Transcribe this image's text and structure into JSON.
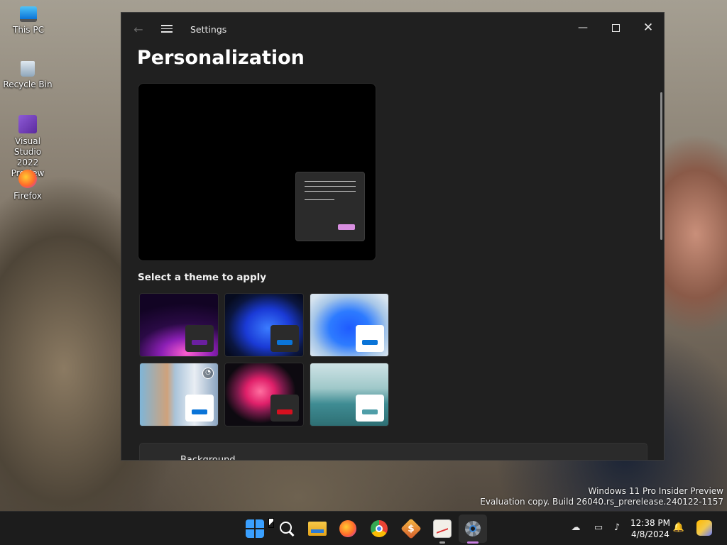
{
  "desktop": {
    "icons": [
      {
        "label": "This PC",
        "icon": "monitor-icon"
      },
      {
        "label": "Recycle Bin",
        "icon": "recycle-bin-icon"
      },
      {
        "label": "Visual Studio 2022 Preview",
        "icon": "visual-studio-icon"
      },
      {
        "label": "Firefox",
        "icon": "firefox-icon"
      }
    ],
    "watermark": {
      "line1": "Windows 11 Pro Insider Preview",
      "line2": "Evaluation copy. Build 26040.rs_prerelease.240122-1157"
    }
  },
  "window": {
    "title": "Settings",
    "controls": {
      "minimize": "—",
      "close": "✕"
    },
    "page_title": "Personalization",
    "theme_section_label": "Select a theme to apply",
    "themes": [
      {
        "name": "theme-glow-dark",
        "accent": "#6a1fa0",
        "swatch_bg": "#2b2b2b"
      },
      {
        "name": "theme-bloom-dark",
        "accent": "#0a74d8",
        "swatch_bg": "#2b2b2b"
      },
      {
        "name": "theme-bloom-light",
        "accent": "#0a74d8",
        "swatch_bg": "#ffffff"
      },
      {
        "name": "theme-spotlight",
        "accent": "#0a74d8",
        "swatch_bg": "#ffffff",
        "selected": true
      },
      {
        "name": "theme-flow",
        "accent": "#d6101f",
        "swatch_bg": "#2b2b2b"
      },
      {
        "name": "theme-sunrise",
        "accent": "#4f9ea8",
        "swatch_bg": "#ffffff"
      }
    ],
    "background_row_label": "Background"
  },
  "taskbar": {
    "apps": [
      {
        "name": "start",
        "icon": "windows-start-icon"
      },
      {
        "name": "search",
        "icon": "search-icon"
      },
      {
        "name": "file-explorer",
        "icon": "folder-icon"
      },
      {
        "name": "firefox",
        "icon": "firefox-icon"
      },
      {
        "name": "chrome",
        "icon": "chrome-icon"
      },
      {
        "name": "money-app",
        "icon": "dollar-icon"
      },
      {
        "name": "image-viewer",
        "icon": "image-icon"
      },
      {
        "name": "settings",
        "icon": "gear-icon",
        "active": true
      }
    ],
    "clock": {
      "time": "12:38 PM",
      "date": "4/8/2024"
    },
    "accent": "#c77ee0"
  }
}
